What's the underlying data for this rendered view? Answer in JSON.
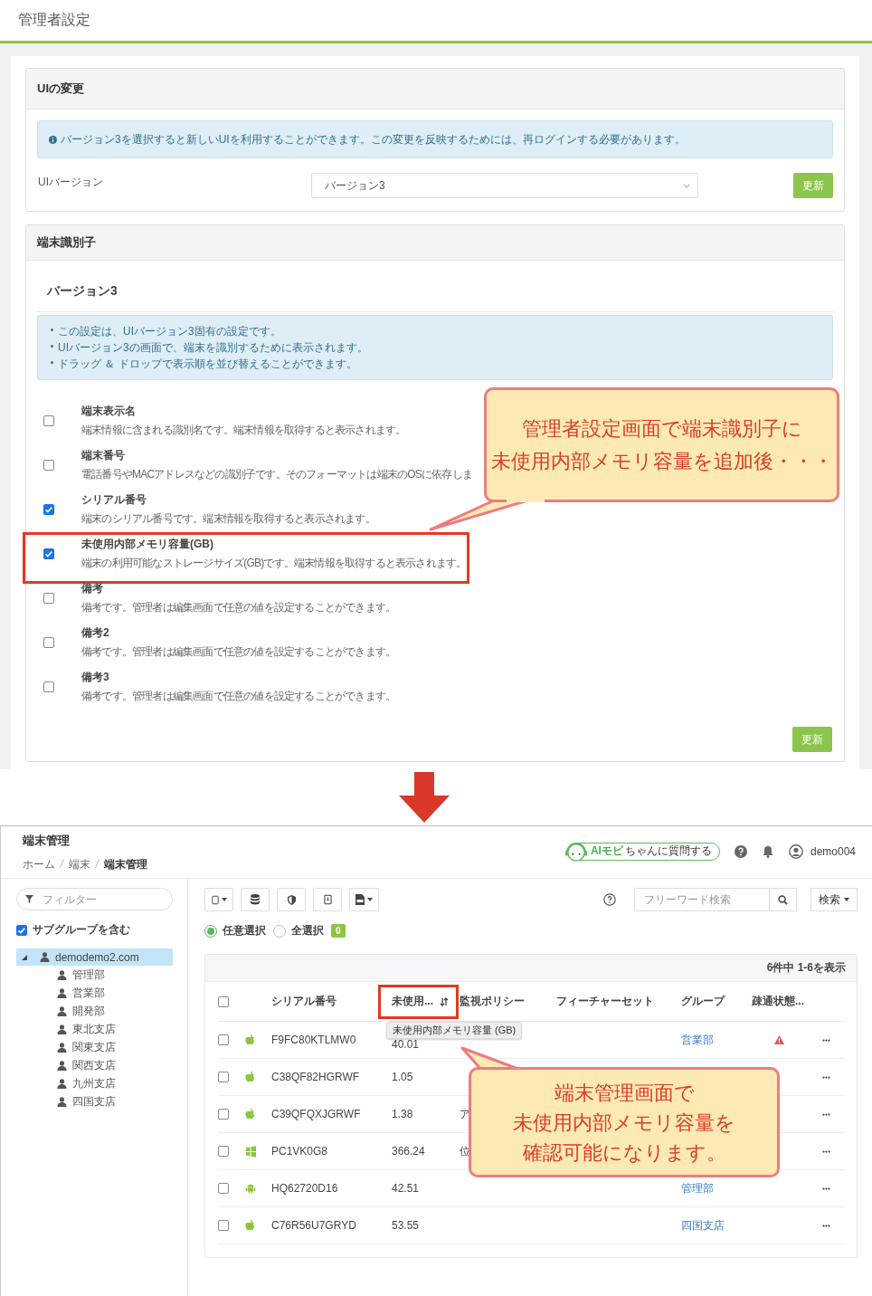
{
  "admin": {
    "title": "管理者設定",
    "ui_panel": {
      "title": "UIの変更",
      "info": "バージョン3を選択すると新しいUIを利用することができます。この変更を反映するためには、再ログインする必要があります。",
      "field_label": "UIバージョン",
      "select_value": "バージョン3",
      "button": "更新"
    },
    "identifier_panel": {
      "title": "端末識別子",
      "subtitle": "バージョン3",
      "notes": [
        "この設定は、UIバージョン3固有の設定です。",
        "UIバージョン3の画面で、端末を識別するために表示されます。",
        "ドラッグ ＆ ドロップで表示順を並び替えることができます。"
      ],
      "options": [
        {
          "label": "端末表示名",
          "description": "端末情報に含まれる識別名です。端末情報を取得すると表示されます。",
          "checked": false,
          "highlighted": false
        },
        {
          "label": "端末番号",
          "description": "電話番号やMACアドレスなどの識別子です。そのフォーマットは端末のOSに依存しま",
          "checked": false,
          "highlighted": false
        },
        {
          "label": "シリアル番号",
          "description": "端末のシリアル番号です。端末情報を取得すると表示されます。",
          "checked": true,
          "highlighted": false
        },
        {
          "label": "未使用内部メモリ容量(GB)",
          "description": "端末の利用可能なストレージサイズ(GB)です。端末情報を取得すると表示されます。",
          "checked": true,
          "highlighted": true
        },
        {
          "label": "備考",
          "description": "備考です。管理者は編集画面で任意の値を設定することができます。",
          "checked": false,
          "highlighted": false
        },
        {
          "label": "備考2",
          "description": "備考です。管理者は編集画面で任意の値を設定することができます。",
          "checked": false,
          "highlighted": false
        },
        {
          "label": "備考3",
          "description": "備考です。管理者は編集画面で任意の値を設定することができます。",
          "checked": false,
          "highlighted": false
        }
      ],
      "button": "更新"
    },
    "callout": {
      "lines": [
        "管理者設定画面で端末識別子に",
        "未使用内部メモリ容量を追加後・・・"
      ]
    }
  },
  "device": {
    "title": "端末管理",
    "breadcrumb": [
      "ホーム",
      "端末",
      "端末管理"
    ],
    "assistant": {
      "brand": "AIモビ",
      "suffix": "ちゃんに質問する"
    },
    "user": "demo004",
    "filter": {
      "placeholder": "フィルター"
    },
    "include_subgroups": {
      "label": "サブグループを含む",
      "checked": true
    },
    "tree": {
      "label": "demodemo2.com",
      "expanded": true,
      "selected": true,
      "children": [
        {
          "label": "管理部"
        },
        {
          "label": "営業部"
        },
        {
          "label": "開発部"
        },
        {
          "label": "東北支店"
        },
        {
          "label": "関東支店"
        },
        {
          "label": "関西支店"
        },
        {
          "label": "九州支店"
        },
        {
          "label": "四国支店"
        }
      ]
    },
    "search": {
      "placeholder": "フリーワード検索",
      "button": "検索"
    },
    "selection": [
      {
        "label": "任意選択",
        "selected": true
      },
      {
        "label": "全選択",
        "selected": false
      }
    ],
    "selected_count": "0",
    "count_text": "6件中 1-6を表示",
    "header_checkbox": {
      "checked": false
    },
    "columns": [
      {
        "label": "シリアル番号",
        "highlighted": false,
        "sortable": false
      },
      {
        "label": "未使用...",
        "highlighted": true,
        "sortable": true
      },
      {
        "label": "監視ポリシー",
        "highlighted": false,
        "sortable": false
      },
      {
        "label": "フィーチャーセット",
        "highlighted": false,
        "sortable": false
      },
      {
        "label": "グループ",
        "highlighted": false,
        "sortable": false
      },
      {
        "label": "疎通状態...",
        "highlighted": false,
        "sortable": false
      }
    ],
    "tooltip": "未使用内部メモリ容量 (GB)",
    "rows": [
      {
        "checked": false,
        "kind": "apple",
        "serial": "F9FC80KTLMW0",
        "free": "40.01",
        "group": "営業部",
        "alert": true
      },
      {
        "checked": false,
        "kind": "apple",
        "serial": "C38QF82HGRWF",
        "free": "1.05",
        "alert": false
      },
      {
        "checked": false,
        "kind": "apple",
        "serial": "C39QFQXJGRWF",
        "free": "1.38",
        "policy": "ア",
        "alert": false
      },
      {
        "checked": false,
        "kind": "windows",
        "serial": "PC1VK0G8",
        "free": "366.24",
        "policy": "位",
        "alert": false
      },
      {
        "checked": false,
        "kind": "android",
        "serial": "HQ62720D16",
        "free": "42.51",
        "group": "管理部",
        "alert": false
      },
      {
        "checked": false,
        "kind": "apple",
        "serial": "C76R56U7GRYD",
        "free": "53.55",
        "group": "四国支店",
        "alert": false
      }
    ],
    "callout": {
      "lines": [
        "端末管理画面で",
        "未使用内部メモリ容量を",
        "確認可能になります。"
      ]
    }
  }
}
